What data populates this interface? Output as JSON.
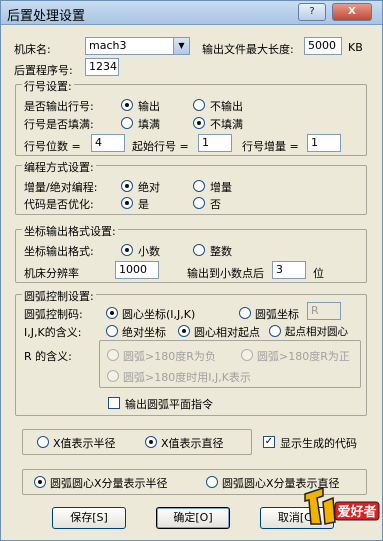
{
  "window": {
    "title": "后置处理设置",
    "help_btn": "?",
    "close_btn": "X"
  },
  "top": {
    "machine_label": "机床名:",
    "machine_value": "mach3",
    "maxlen_label": "输出文件最大长度:",
    "maxlen_value": "5000",
    "maxlen_unit": "KB",
    "postprog_label": "后置程序号:",
    "postprog_value": "1234"
  },
  "line_group": {
    "legend": "行号设置:",
    "output_label": "是否输出行号:",
    "output_yes": "输出",
    "output_no": "不输出",
    "fill_label": "行号是否填满:",
    "fill_yes": "填满",
    "fill_no": "不填满",
    "digits_label": "行号位数 =",
    "digits_value": "4",
    "start_label": "起始行号 =",
    "start_value": "1",
    "inc_label": "行号增量 =",
    "inc_value": "1"
  },
  "prog_group": {
    "legend": "编程方式设置:",
    "mode_label": "增量/绝对编程:",
    "mode_abs": "绝对",
    "mode_inc": "增量",
    "opt_label": "代码是否优化:",
    "opt_yes": "是",
    "opt_no": "否"
  },
  "coord_group": {
    "legend": "坐标输出格式设置:",
    "fmt_label": "坐标输出格式:",
    "fmt_decimal": "小数",
    "fmt_integer": "整数",
    "res_label": "机床分辨率",
    "res_value": "1000",
    "dec_label": "输出到小数点后",
    "dec_value": "3",
    "dec_unit": "位"
  },
  "arc_group": {
    "legend": "圆弧控制设置:",
    "code_label": "圆弧控制码:",
    "code_center": "圆心坐标(I,J,K)",
    "code_radius": "圆弧坐标",
    "code_radius_value": "R",
    "ijk_label": "I,J,K的含义:",
    "ijk_abs": "绝对坐标",
    "ijk_rel_center": "圆心相对起点",
    "ijk_rel_start": "起点相对圆心",
    "r_label": "R 的含义:",
    "r_opt1": "圆弧>180度R为负",
    "r_opt2": "圆弧>180度R为正",
    "r_opt3": "圆弧>180度时用I,J,K表示",
    "plane_label": "输出圆弧平面指令"
  },
  "xval": {
    "radius": "X值表示半径",
    "diameter": "X值表示直径",
    "show_code": "显示生成的代码",
    "show_code_mark": "✓"
  },
  "arc_x": {
    "radius": "圆弧圆心X分量表示半径",
    "diameter": "圆弧圆心X分量表示直径"
  },
  "buttons": {
    "save": "保存[S]",
    "ok": "确定[O]",
    "cancel": "取消[C]"
  },
  "watermark": {
    "text": "爱好者"
  }
}
